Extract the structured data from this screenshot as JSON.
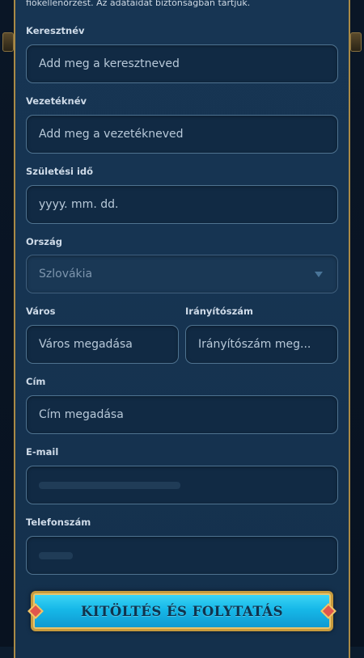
{
  "intro_text": "fiókellenőrzést. Az adataidat biztonságban tartjuk.",
  "fields": {
    "first_name": {
      "label": "Keresztnév",
      "placeholder": "Add meg a keresztneved"
    },
    "last_name": {
      "label": "Vezetéknév",
      "placeholder": "Add meg a vezetékneved"
    },
    "birth_date": {
      "label": "Születési idő",
      "placeholder": "yyyy. mm. dd."
    },
    "country": {
      "label": "Ország",
      "value": "Szlovákia"
    },
    "city": {
      "label": "Város",
      "placeholder": "Város megadása"
    },
    "zip": {
      "label": "Irányítószám",
      "placeholder": "Irányítószám meg..."
    },
    "address": {
      "label": "Cím",
      "placeholder": "Cím megadása"
    },
    "email": {
      "label": "E-mail"
    },
    "phone": {
      "label": "Telefonszám"
    }
  },
  "submit_label": "KITÖLTÉS ÉS FOLYTATÁS",
  "icons": {
    "country_dropdown": "chevron-down-icon",
    "cta_left": "gem-icon",
    "cta_right": "gem-icon"
  },
  "colors": {
    "panel": "#173553",
    "frame_gold": "#a98a46",
    "field_border": "#4f7390",
    "cta_blue": "#16b8e8"
  }
}
